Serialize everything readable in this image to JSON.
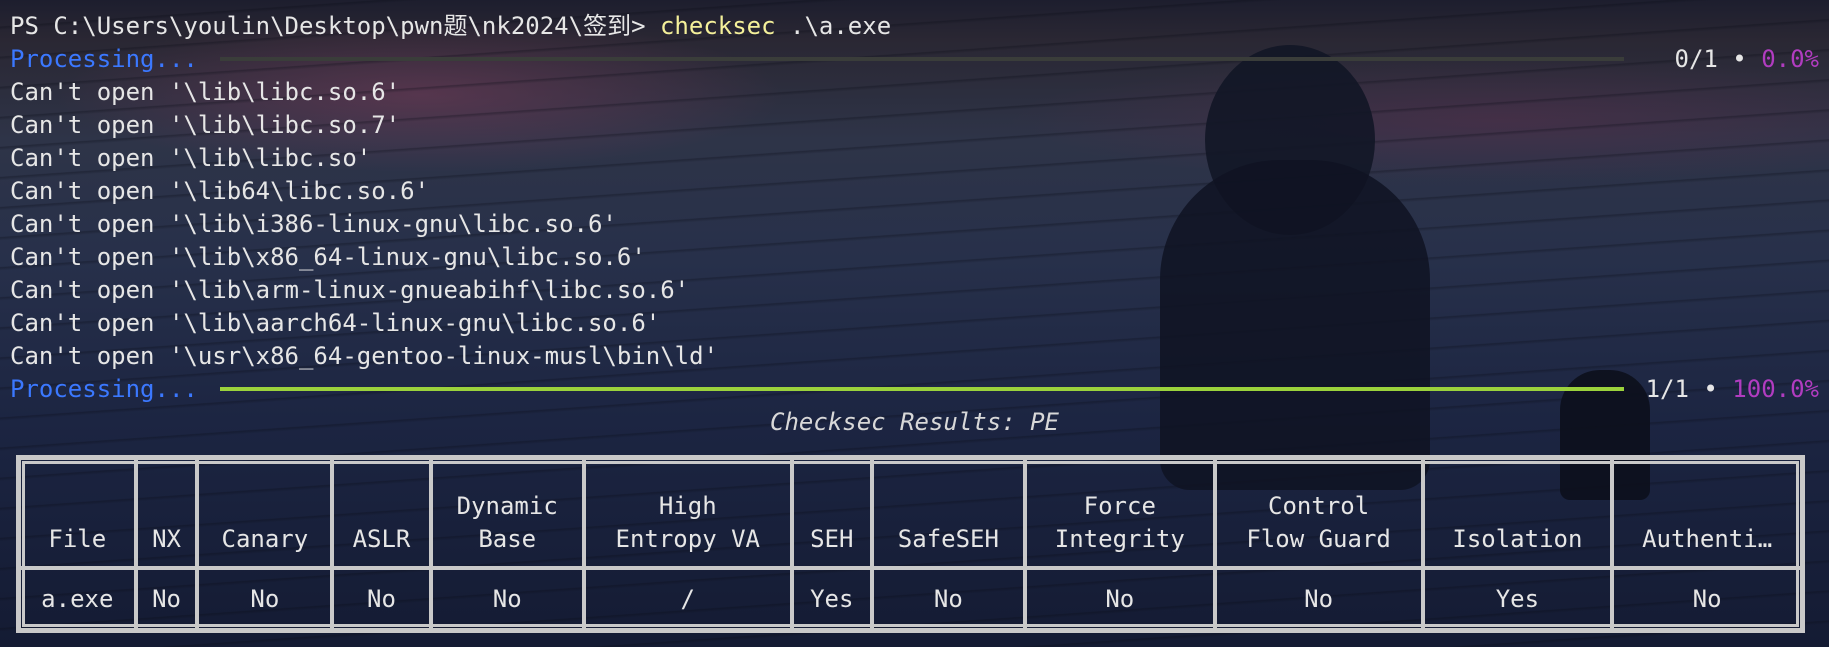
{
  "terminal": {
    "prompt_path": "PS C:\\Users\\youlin\\Desktop\\pwn题\\nk2024\\签到> ",
    "command": "checksec",
    "argument": " .\\a.exe",
    "processing_label": "Processing...",
    "progress_start": {
      "count": "0/1 • ",
      "percent": "0.0%",
      "fraction": 0.0
    },
    "errors": [
      "Can't open '\\lib\\libc.so.6'",
      "Can't open '\\lib\\libc.so.7'",
      "Can't open '\\lib\\libc.so'",
      "Can't open '\\lib64\\libc.so.6'",
      "Can't open '\\lib\\i386-linux-gnu\\libc.so.6'",
      "Can't open '\\lib\\x86_64-linux-gnu\\libc.so.6'",
      "Can't open '\\lib\\arm-linux-gnueabihf\\libc.so.6'",
      "Can't open '\\lib\\aarch64-linux-gnu\\libc.so.6'",
      "Can't open '\\usr\\x86_64-gentoo-linux-musl\\bin\\ld'"
    ],
    "progress_end": {
      "count": "1/1 • ",
      "percent": "100.0%",
      "fraction": 1.0
    }
  },
  "results": {
    "title": "Checksec Results: PE",
    "headers": [
      [
        "File"
      ],
      [
        "NX"
      ],
      [
        "Canary"
      ],
      [
        "ASLR"
      ],
      [
        "Dynamic",
        "Base"
      ],
      [
        "High",
        "Entropy VA"
      ],
      [
        "SEH"
      ],
      [
        "SafeSEH"
      ],
      [
        "Force",
        "Integrity"
      ],
      [
        "Control",
        "Flow Guard"
      ],
      [
        "Isolation"
      ],
      [
        "Authenti…"
      ]
    ],
    "row": [
      {
        "value": "a.exe",
        "status": "neutral"
      },
      {
        "value": "No",
        "status": "no"
      },
      {
        "value": "No",
        "status": "no"
      },
      {
        "value": "No",
        "status": "no"
      },
      {
        "value": "No",
        "status": "no"
      },
      {
        "value": "/",
        "status": "neutral"
      },
      {
        "value": "Yes",
        "status": "yes"
      },
      {
        "value": "No",
        "status": "no"
      },
      {
        "value": "No",
        "status": "no"
      },
      {
        "value": "No",
        "status": "no"
      },
      {
        "value": "Yes",
        "status": "yes"
      },
      {
        "value": "No",
        "status": "no"
      }
    ]
  },
  "colors": {
    "no": "#e0303a",
    "yes": "#3cc43c",
    "processing": "#3b78ff",
    "percent": "#b13cc0",
    "progress_fill": "#9bd23c",
    "command": "#f4f09a"
  }
}
